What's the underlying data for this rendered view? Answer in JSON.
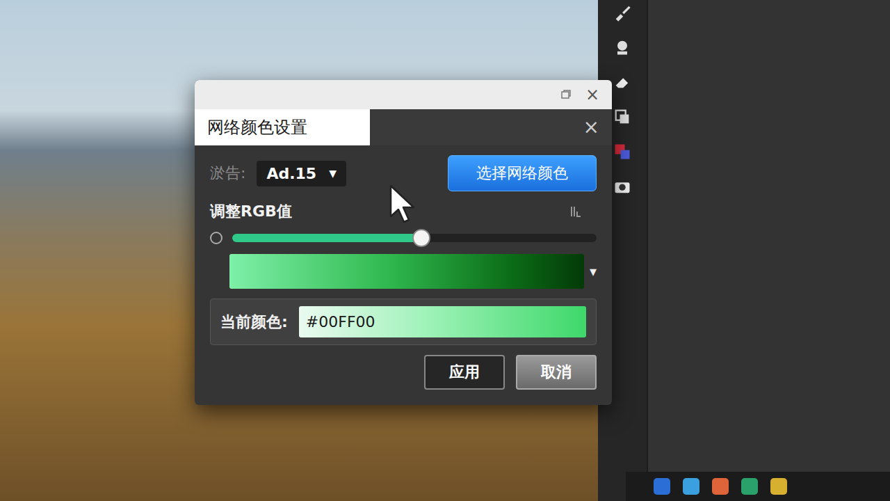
{
  "outer_window": {
    "close": "×"
  },
  "window": {
    "title": "网络颜色设置",
    "close": "×"
  },
  "ad_row": {
    "label": "淤告:",
    "dropdown": {
      "value": "Ad.15",
      "arrow": "▼"
    }
  },
  "pick_button": "选择网络颜色",
  "rgb": {
    "label": "调整RGB值",
    "level": 0.52
  },
  "gradient": {
    "arrow": "▾"
  },
  "current_color": {
    "label": "当前颜色:",
    "value": "#00FF00"
  },
  "buttons": [
    "应用",
    "取消"
  ]
}
